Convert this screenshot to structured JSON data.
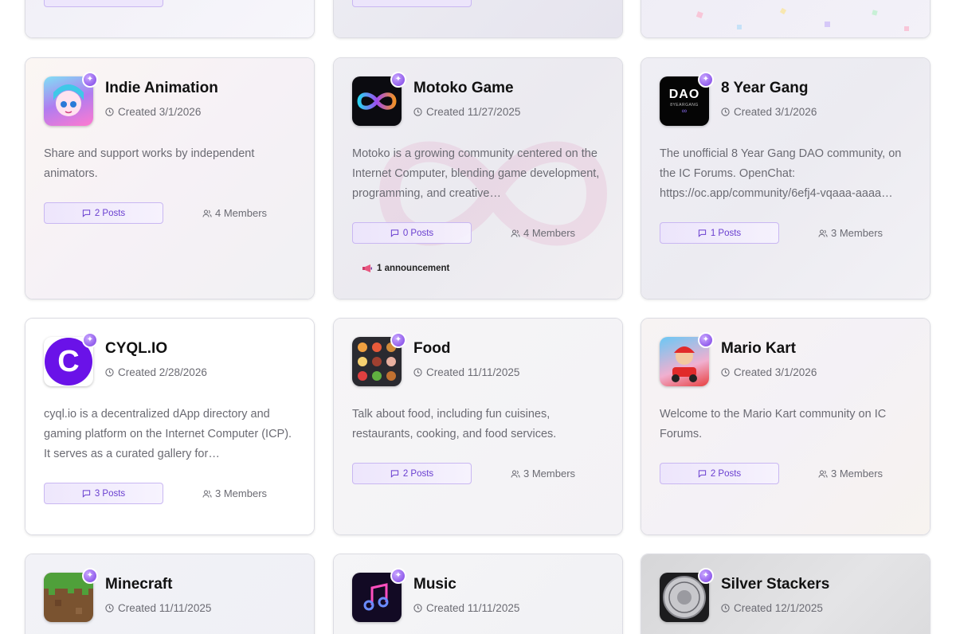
{
  "top_row": {
    "posts_label": "Posts",
    "members_label": "Members"
  },
  "cards": [
    {
      "name": "Indie Animation",
      "created": "Created 3/1/2026",
      "description": "Share and support works by independent animators.",
      "posts": "2 Posts",
      "members": "4 Members"
    },
    {
      "name": "Motoko Game",
      "created": "Created 11/27/2025",
      "description": "Motoko is a growing community centered on the Internet Computer, blending game development, programming, and creative…",
      "posts": "0 Posts",
      "members": "4 Members",
      "announcement": "1 announcement"
    },
    {
      "name": "8 Year Gang",
      "created": "Created 3/1/2026",
      "description": "The unofficial 8 Year Gang DAO community, on the IC Forums. OpenChat: https://oc.app/community/6efj4-vqaaa-aaaa…",
      "posts": "1 Posts",
      "members": "3 Members",
      "logo_text": "DAO",
      "logo_subtext": "8YEARGANG"
    },
    {
      "name": "CYQL.IO",
      "created": "Created 2/28/2026",
      "description": "cyql.io is a decentralized dApp directory and gaming platform on the Internet Computer (ICP). It serves as a curated gallery for…",
      "posts": "3 Posts",
      "members": "3 Members",
      "logo_text": "C"
    },
    {
      "name": "Food",
      "created": "Created 11/11/2025",
      "description": "Talk about food, including fun cuisines, restaurants, cooking, and food services.",
      "posts": "2 Posts",
      "members": "3 Members"
    },
    {
      "name": "Mario Kart",
      "created": "Created 3/1/2026",
      "description": "Welcome to the Mario Kart community on IC Forums.",
      "posts": "2 Posts",
      "members": "3 Members"
    },
    {
      "name": "Minecraft",
      "created": "Created 11/11/2025"
    },
    {
      "name": "Music",
      "created": "Created 11/11/2025"
    },
    {
      "name": "Silver Stackers",
      "created": "Created 12/1/2025"
    }
  ],
  "icons": {
    "clock": "clock-icon",
    "message": "message-square-icon",
    "users": "users-icon",
    "badge": "sparkle-badge-icon",
    "announcement": "megaphone-icon"
  },
  "colors": {
    "accent": "#6a3fd0",
    "accent_light": "#ece4fc",
    "badge": "#8b4cf0",
    "muted_text": "#6b6b73",
    "card_border": "#dcdce3"
  }
}
